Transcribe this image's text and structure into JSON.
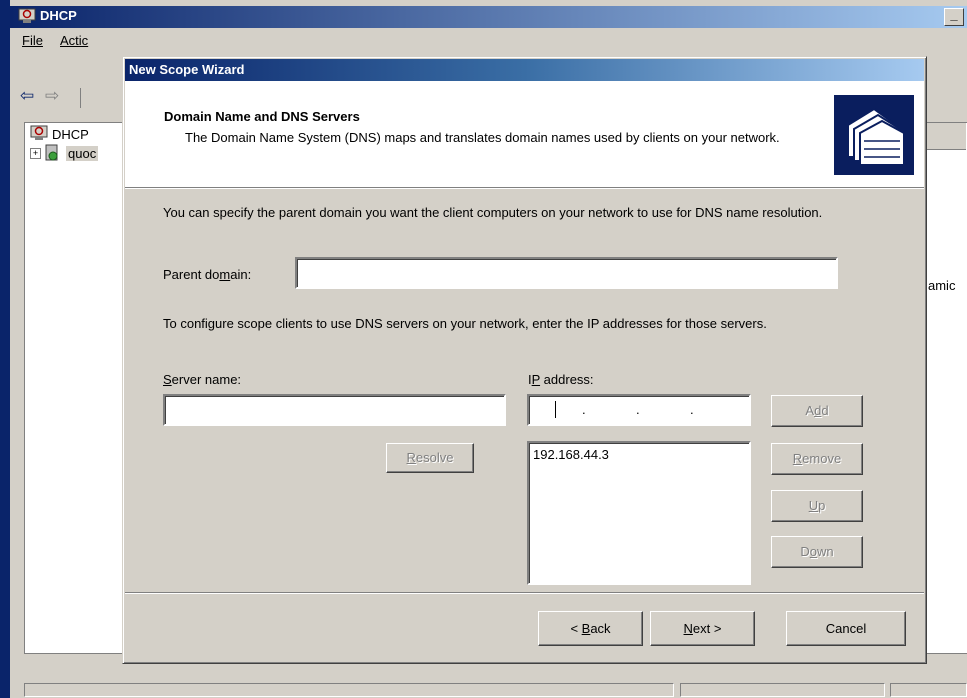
{
  "background_app": {
    "title": "DHCP",
    "menu": [
      "File",
      "Actic"
    ],
    "tree": {
      "root": "DHCP",
      "child": "quoc"
    },
    "right_text": "amic"
  },
  "wizard": {
    "title": "New Scope Wizard",
    "header_title": "Domain Name and DNS Servers",
    "header_desc": "The Domain Name System (DNS) maps and translates domain names used by clients on your network.",
    "intro": "You can specify the parent domain you want the client computers on your network to use for DNS name resolution.",
    "parent_domain_label_pre": "Parent do",
    "parent_domain_label_acc": "m",
    "parent_domain_label_post": "ain:",
    "parent_domain_value": "",
    "config_text": "To configure scope clients to use DNS servers on your network, enter the IP addresses for those servers.",
    "server_name_label_acc": "S",
    "server_name_label_post": "erver name:",
    "server_name_value": "",
    "ip_label_pre": "I",
    "ip_label_acc": "P",
    "ip_label_post": " address:",
    "ip_list": [
      "192.168.44.3"
    ],
    "buttons": {
      "resolve_acc": "R",
      "resolve_post": "esolve",
      "add_pre": "A",
      "add_acc": "d",
      "add_post": "d",
      "remove_acc": "R",
      "remove_post": "emove",
      "up_acc": "U",
      "up_post": "p",
      "down_pre": "D",
      "down_acc": "o",
      "down_post": "wn",
      "back_pre": "< ",
      "back_acc": "B",
      "back_post": "ack",
      "next_acc": "N",
      "next_post": "ext >",
      "cancel": "Cancel"
    }
  }
}
